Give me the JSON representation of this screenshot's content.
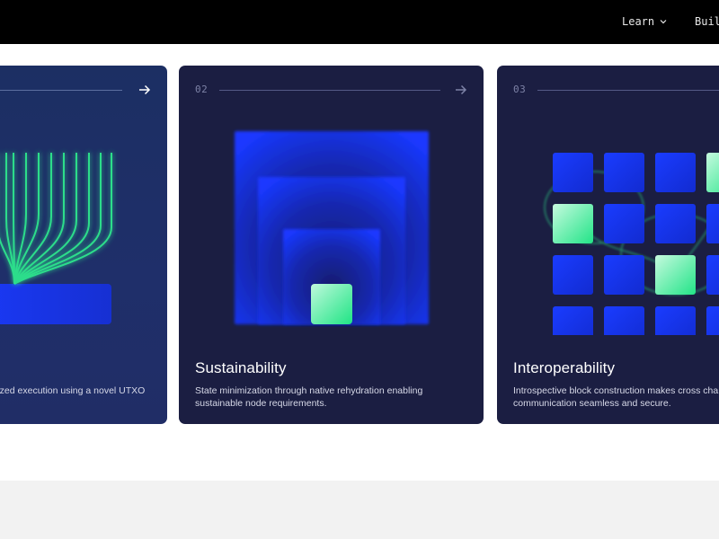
{
  "nav": {
    "items": [
      {
        "label": "Learn",
        "has_chevron": true
      },
      {
        "label": "Buil",
        "has_chevron": false
      }
    ]
  },
  "cards": [
    {
      "number": "",
      "title": "",
      "desc_lines": [
        "lized execution using a novel UTXO"
      ],
      "arrow": "arrow-right-icon"
    },
    {
      "number": "02",
      "title": "Sustainability",
      "desc_lines": [
        "State minimization through native rehydration enabling",
        "sustainable node requirements."
      ],
      "arrow": "arrow-right-icon"
    },
    {
      "number": "03",
      "title": "Interoperability",
      "desc_lines": [
        "Introspective block construction makes cross cha",
        "communication seamless and secure."
      ],
      "arrow": "arrow-right-icon"
    }
  ],
  "colors": {
    "accent_green": "#2ef08f",
    "accent_blue": "#1436ff",
    "card_bg": "#1b1e42"
  }
}
